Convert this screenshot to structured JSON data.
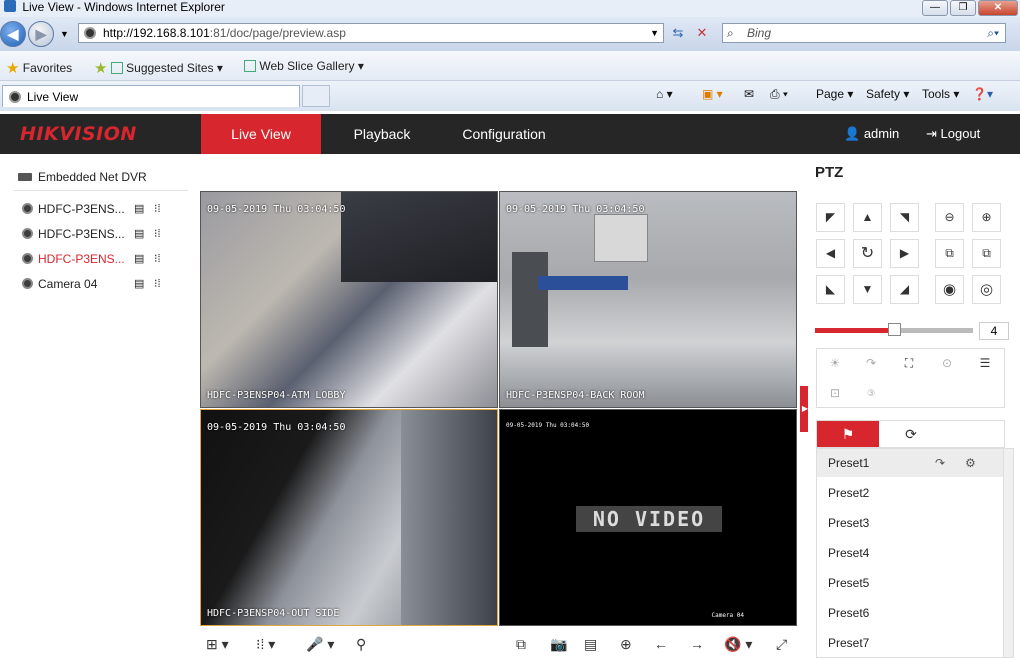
{
  "browser": {
    "title": "Live View - Windows Internet Explorer",
    "url_host": "http://192.168.8.101",
    "url_path": ":81/doc/page/preview.asp",
    "search_placeholder": "Bing",
    "favorites_label": "Favorites",
    "suggested_sites": "Suggested Sites",
    "web_slice": "Web Slice Gallery",
    "tab_label": "Live View",
    "cmd_page": "Page",
    "cmd_safety": "Safety",
    "cmd_tools": "Tools"
  },
  "app": {
    "logo": "HIKVISION",
    "nav": [
      "Live View",
      "Playback",
      "Configuration"
    ],
    "active_nav": "Live View",
    "user": "admin",
    "logout": "Logout",
    "accent_color": "#d7262e"
  },
  "sidebar": {
    "device": "Embedded Net DVR",
    "cameras": [
      {
        "label": "HDFC-P3ENS...",
        "active": false
      },
      {
        "label": "HDFC-P3ENS...",
        "active": false
      },
      {
        "label": "HDFC-P3ENS...",
        "active": true
      },
      {
        "label": "Camera 04",
        "active": false
      }
    ]
  },
  "video": {
    "tiles": [
      {
        "timestamp": "09-05-2019 Thu 03:04:50",
        "name": "HDFC-P3ENSP04-ATM LOBBY"
      },
      {
        "timestamp": "09-05-2019 Thu 03:04:50",
        "name": "HDFC-P3ENSP04-BACK ROOM"
      },
      {
        "timestamp": "09-05-2019 Thu 03:04:50",
        "name": "HDFC-P3ENSP04-OUT SIDE"
      },
      {
        "timestamp": "09-05-2019 Thu 03:04:50",
        "name": "Camera 04",
        "no_video": "NO VIDEO"
      }
    ]
  },
  "ptz": {
    "title": "PTZ",
    "speed": "4",
    "speed_fraction": 0.5,
    "presets": [
      "Preset1",
      "Preset2",
      "Preset3",
      "Preset4",
      "Preset5",
      "Preset6",
      "Preset7"
    ]
  }
}
